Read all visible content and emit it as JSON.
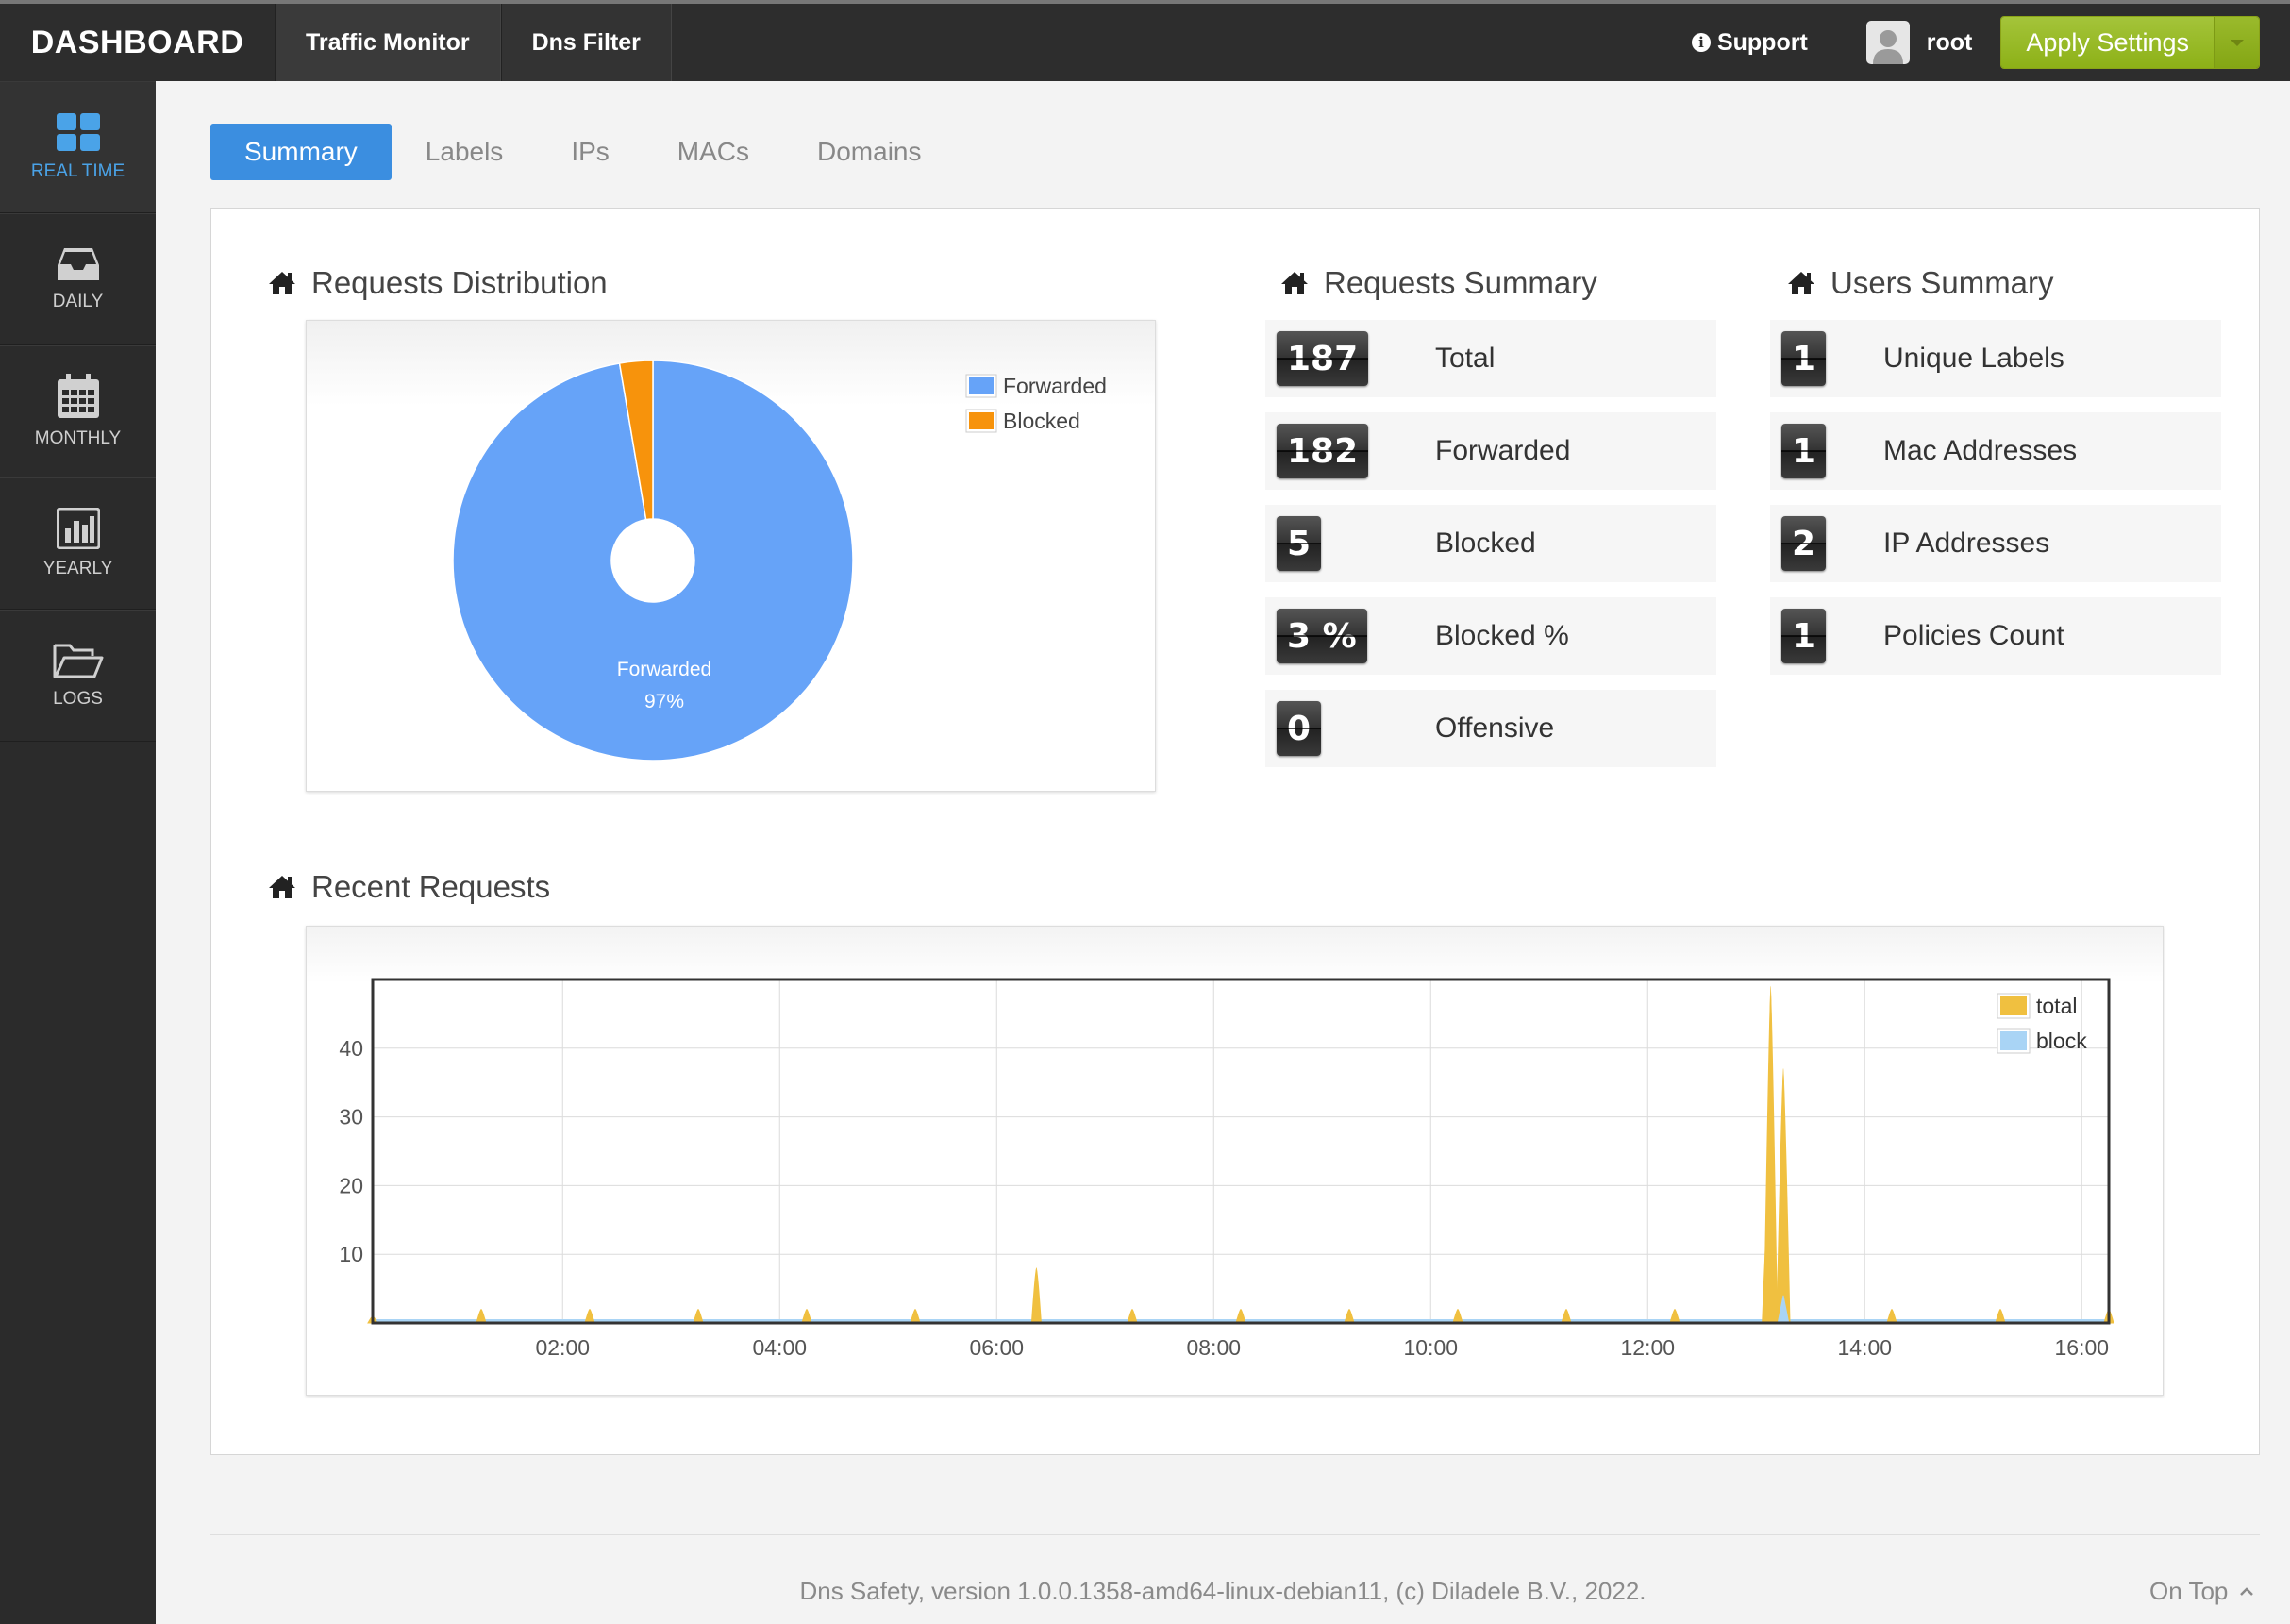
{
  "header": {
    "brand": "DASHBOARD",
    "nav": [
      "Traffic Monitor",
      "Dns Filter"
    ],
    "support_label": "Support",
    "user_name": "root",
    "apply_label": "Apply Settings"
  },
  "sidebar": {
    "items": [
      {
        "label": "REAL TIME",
        "icon": "grid-icon"
      },
      {
        "label": "DAILY",
        "icon": "inbox-icon"
      },
      {
        "label": "MONTHLY",
        "icon": "calendar-icon"
      },
      {
        "label": "YEARLY",
        "icon": "bar-chart-icon"
      },
      {
        "label": "LOGS",
        "icon": "folder-icon"
      }
    ]
  },
  "tabs": [
    "Summary",
    "Labels",
    "IPs",
    "MACs",
    "Domains"
  ],
  "sections": {
    "distribution": "Requests Distribution",
    "requests_summary": "Requests Summary",
    "users_summary": "Users Summary",
    "recent": "Recent Requests"
  },
  "requests_summary": [
    {
      "value": "187",
      "label": "Total"
    },
    {
      "value": "182",
      "label": "Forwarded"
    },
    {
      "value": "5",
      "label": "Blocked"
    },
    {
      "value": "3 %",
      "label": "Blocked %"
    },
    {
      "value": "0",
      "label": "Offensive"
    }
  ],
  "users_summary": [
    {
      "value": "1",
      "label": "Unique Labels"
    },
    {
      "value": "1",
      "label": "Mac Addresses"
    },
    {
      "value": "2",
      "label": "IP Addresses"
    },
    {
      "value": "1",
      "label": "Policies Count"
    }
  ],
  "colors": {
    "forwarded": "#66a3f8",
    "blocked": "#f7930c",
    "total": "#f0c040",
    "block": "#a9d4f5",
    "accent": "#3b8ee0",
    "apply": "#94b820"
  },
  "chart_data": [
    {
      "type": "pie",
      "categories": [
        "Forwarded",
        "Blocked"
      ],
      "values": [
        182,
        5
      ],
      "slice_label": {
        "name": "Forwarded",
        "percent": "97%"
      },
      "legend": "top-right"
    },
    {
      "type": "line",
      "x_ticks": [
        "02:00",
        "04:00",
        "06:00",
        "08:00",
        "10:00",
        "12:00",
        "14:00",
        "16:00"
      ],
      "y_ticks": [
        10,
        20,
        30,
        40
      ],
      "xlim": [
        "00:15",
        "16:15"
      ],
      "ylim": [
        0,
        50
      ],
      "legend": "top-right",
      "grid": true,
      "series": [
        {
          "name": "total",
          "points": [
            [
              "00:15",
              1
            ],
            [
              "01:15",
              2
            ],
            [
              "02:15",
              2
            ],
            [
              "03:15",
              2
            ],
            [
              "04:15",
              2
            ],
            [
              "05:15",
              2
            ],
            [
              "06:22",
              8
            ],
            [
              "07:15",
              2
            ],
            [
              "08:15",
              2
            ],
            [
              "09:15",
              2
            ],
            [
              "10:15",
              2
            ],
            [
              "11:15",
              2
            ],
            [
              "12:15",
              2
            ],
            [
              "13:07",
              20
            ],
            [
              "13:08",
              49
            ],
            [
              "13:10",
              3
            ],
            [
              "13:15",
              37
            ],
            [
              "14:15",
              2
            ],
            [
              "15:15",
              2
            ],
            [
              "16:15",
              2
            ]
          ]
        },
        {
          "name": "block",
          "points": [
            [
              "13:12",
              0
            ],
            [
              "13:15",
              4
            ],
            [
              "13:18",
              0
            ]
          ]
        }
      ]
    }
  ],
  "footer": {
    "text": "Dns Safety, version 1.0.0.1358-amd64-linux-debian11, (c) Diladele B.V., 2022.",
    "on_top": "On Top"
  }
}
